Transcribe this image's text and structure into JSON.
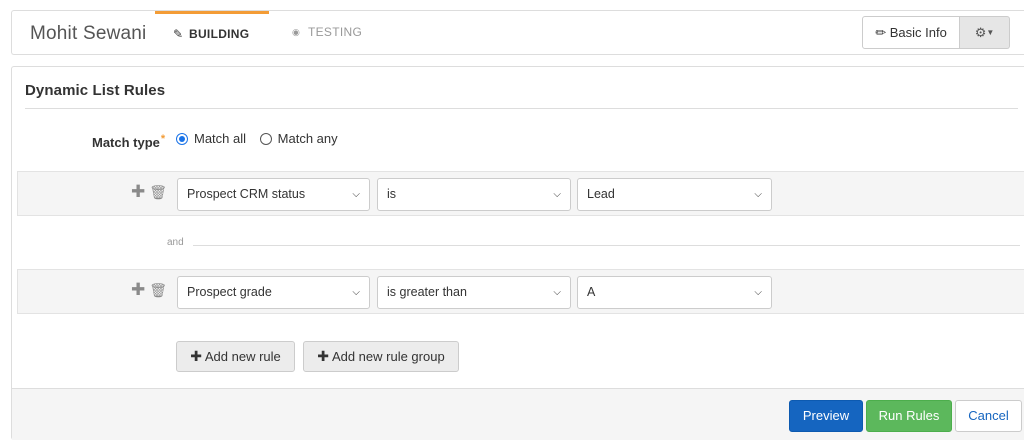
{
  "header": {
    "brand": "Mohit Sewani",
    "tabs": [
      {
        "label": "BUILDING",
        "icon": "edit-icon",
        "active": true
      },
      {
        "label": "TESTING",
        "icon": "record-icon",
        "active": false
      }
    ],
    "basic_info_label": "Basic Info",
    "basic_info_icon": "pencil-icon",
    "settings_icon": "gear-icon"
  },
  "panel": {
    "title": "Dynamic List Rules",
    "match_type": {
      "label": "Match type",
      "options": [
        {
          "label": "Match all",
          "selected": true
        },
        {
          "label": "Match any",
          "selected": false
        }
      ]
    },
    "rules": [
      {
        "field": "Prospect CRM status",
        "operator": "is",
        "value": "Lead"
      },
      {
        "field": "Prospect grade",
        "operator": "is greater than",
        "value": "A"
      }
    ],
    "connector": "and",
    "add_rule_label": "Add new rule",
    "add_group_label": "Add new rule group"
  },
  "footer": {
    "preview_label": "Preview",
    "run_label": "Run Rules",
    "cancel_label": "Cancel"
  },
  "colors": {
    "accent_tab": "#f39c36",
    "primary": "#1565c0",
    "success": "#5cb85c",
    "radio": "#1a73e8"
  }
}
